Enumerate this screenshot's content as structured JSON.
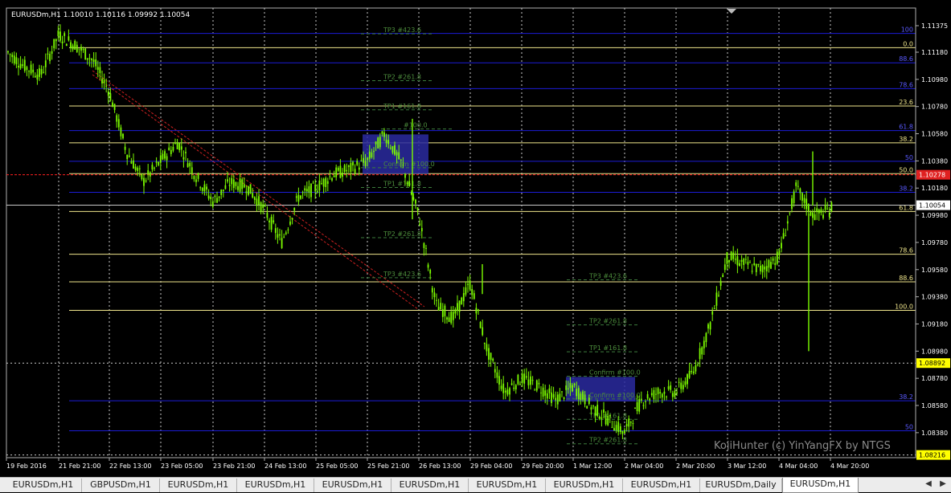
{
  "header": {
    "symbol": "EURUSDm,H1",
    "ohlc": "1.10010 1.10116 1.09992 1.10054"
  },
  "watermark": "KojiHunter (c) YinYangFX by NTGS",
  "tabs": [
    {
      "label": "EURUSDm,H1",
      "active": false
    },
    {
      "label": "GBPUSDm,H1",
      "active": false
    },
    {
      "label": "EURUSDm,H1",
      "active": false
    },
    {
      "label": "EURUSDm,H1",
      "active": false
    },
    {
      "label": "EURUSDm,H1",
      "active": false
    },
    {
      "label": "EURUSDm,H1",
      "active": false
    },
    {
      "label": "EURUSDm,H1",
      "active": false
    },
    {
      "label": "EURUSDm,H1",
      "active": false
    },
    {
      "label": "EURUSDm,H1",
      "active": false
    },
    {
      "label": "EURUSDm,Daily",
      "active": false
    },
    {
      "label": "EURUSDm,H1",
      "active": true
    }
  ],
  "colors": {
    "background": "#000000",
    "candle": "#7CFC00",
    "blue_level": "#1c1cd6",
    "yellow_level": "#f0e68c",
    "grid": "#c8c8c8",
    "red_line": "#ff2020",
    "trend": "#cc2020",
    "label_blue": "#5a5aff",
    "zone": "#2a2aa0"
  },
  "icons": {
    "scroll_left": "arrow-left-icon",
    "scroll_right": "arrow-right-icon"
  },
  "chart_data": {
    "type": "candlestick",
    "symbol": "EURUSDm",
    "timeframe": "H1",
    "x_ticks": [
      "19 Feb 2016",
      "21 Feb 21:00",
      "22 Feb 13:00",
      "23 Feb 05:00",
      "23 Feb 21:00",
      "24 Feb 13:00",
      "25 Feb 05:00",
      "25 Feb 21:00",
      "26 Feb 13:00",
      "29 Feb 04:00",
      "29 Feb 20:00",
      "1 Mar 12:00",
      "2 Mar 04:00",
      "2 Mar 20:00",
      "3 Mar 12:00",
      "4 Mar 04:00",
      "4 Mar 20:00"
    ],
    "y_ticks": [
      1.11375,
      1.1118,
      1.1098,
      1.1078,
      1.1058,
      1.1038,
      1.1018,
      1.0998,
      1.0978,
      1.0958,
      1.0938,
      1.0918,
      1.0898,
      1.0878,
      1.0858,
      1.0838
    ],
    "ylim": [
      1.08196,
      1.11505
    ],
    "current_price": 1.10054,
    "highlighted_prices": [
      {
        "label": "1.10278",
        "price": 1.10278,
        "style": "red"
      },
      {
        "label": "1.10054",
        "price": 1.10054,
        "style": "white"
      },
      {
        "label": "1.08892",
        "price": 1.08892,
        "style": "yellow"
      },
      {
        "label": "1.08216",
        "price": 1.08216,
        "style": "yellow"
      }
    ],
    "fib_levels_right": [
      {
        "label": "100",
        "price": 1.11318,
        "color": "blue"
      },
      {
        "label": "0.0",
        "price": 1.11213,
        "color": "yellow"
      },
      {
        "label": "88.6",
        "price": 1.11102,
        "color": "blue"
      },
      {
        "label": "78.6",
        "price": 1.10912,
        "color": "blue"
      },
      {
        "label": "23.6",
        "price": 1.10784,
        "color": "yellow"
      },
      {
        "label": "61.8",
        "price": 1.10603,
        "color": "blue"
      },
      {
        "label": "38.2",
        "price": 1.10513,
        "color": "yellow"
      },
      {
        "label": "50",
        "price": 1.10377,
        "color": "blue"
      },
      {
        "label": "50.0",
        "price": 1.10286,
        "color": "yellow"
      },
      {
        "label": "38.2",
        "price": 1.10149,
        "color": "blue"
      },
      {
        "label": "61.8",
        "price": 1.10008,
        "color": "yellow"
      },
      {
        "label": "78.6",
        "price": 1.09693,
        "color": "yellow"
      },
      {
        "label": "88.6",
        "price": 1.0949,
        "color": "yellow"
      },
      {
        "label": "100.0",
        "price": 1.0928,
        "color": "yellow"
      },
      {
        "label": "38.2",
        "price": 1.08615,
        "color": "blue"
      },
      {
        "label": "50",
        "price": 1.08394,
        "color": "blue"
      }
    ],
    "trade_labels": [
      {
        "label": "TP3 #423.6",
        "price": 1.11315,
        "time": "25 Feb 13:00"
      },
      {
        "label": "TP2 #261.8",
        "price": 1.1097,
        "time": "25 Feb 13:00"
      },
      {
        "label": "TP1 #161.8",
        "price": 1.10756,
        "time": "25 Feb 13:00"
      },
      {
        "label": "#100.0",
        "price": 1.10615,
        "time": "25 Feb 21:00"
      },
      {
        "label": "Confirm #100.0",
        "price": 1.1033,
        "time": "25 Feb 13:00"
      },
      {
        "label": "TP1 #161.8",
        "price": 1.10184,
        "time": "25 Feb 13:00"
      },
      {
        "label": "TP2 #261.8",
        "price": 1.09815,
        "time": "25 Feb 13:00"
      },
      {
        "label": "TP3 #423.6",
        "price": 1.0952,
        "time": "25 Feb 13:00"
      },
      {
        "label": "TP3 #423.6",
        "price": 1.09505,
        "time": "1 Mar 12:00"
      },
      {
        "label": "TP2 #261.8",
        "price": 1.09173,
        "time": "1 Mar 12:00"
      },
      {
        "label": "TP1 #161.8",
        "price": 1.08975,
        "time": "1 Mar 12:00"
      },
      {
        "label": "Confirm #100.0",
        "price": 1.08795,
        "time": "1 Mar 12:00"
      },
      {
        "label": "Confirm #100.0",
        "price": 1.08628,
        "time": "1 Mar 12:00"
      },
      {
        "label": "TP1 #161.8",
        "price": 1.08478,
        "time": "1 Mar 12:00"
      },
      {
        "label": "TP2 #261.8",
        "price": 1.08298,
        "time": "1 Mar 12:00"
      }
    ],
    "price_path": [
      [
        "19 Feb 2016",
        1.1119
      ],
      [
        "19 Feb 2016",
        1.1108
      ],
      [
        "19 Feb 2016",
        1.1101
      ],
      [
        "21 Feb 21:00",
        1.1131
      ],
      [
        "21 Feb 21:00",
        1.1123
      ],
      [
        "21 Feb 21:00",
        1.1112
      ],
      [
        "22 Feb 13:00",
        1.1089
      ],
      [
        "22 Feb 13:00",
        1.1045
      ],
      [
        "22 Feb 13:00",
        1.1023
      ],
      [
        "23 Feb 05:00",
        1.1038
      ],
      [
        "23 Feb 05:00",
        1.1052
      ],
      [
        "23 Feb 05:00",
        1.1028
      ],
      [
        "23 Feb 21:00",
        1.1008
      ],
      [
        "23 Feb 21:00",
        1.1022
      ],
      [
        "23 Feb 21:00",
        1.1019
      ],
      [
        "24 Feb 13:00",
        1.1002
      ],
      [
        "24 Feb 13:00",
        1.0978
      ],
      [
        "24 Feb 13:00",
        1.1012
      ],
      [
        "25 Feb 05:00",
        1.1018
      ],
      [
        "25 Feb 05:00",
        1.1028
      ],
      [
        "25 Feb 05:00",
        1.1032
      ],
      [
        "25 Feb 21:00",
        1.1038
      ],
      [
        "25 Feb 21:00",
        1.1058
      ],
      [
        "25 Feb 21:00",
        1.1036
      ],
      [
        "26 Feb 13:00",
        1.0998
      ],
      [
        "26 Feb 13:00",
        1.0932
      ],
      [
        "26 Feb 13:00",
        1.0922
      ],
      [
        "29 Feb 04:00",
        1.0948
      ],
      [
        "29 Feb 04:00",
        1.0898
      ],
      [
        "29 Feb 04:00",
        1.0868
      ],
      [
        "29 Feb 20:00",
        1.0878
      ],
      [
        "29 Feb 20:00",
        1.0872
      ],
      [
        "29 Feb 20:00",
        1.0862
      ],
      [
        "1 Mar 12:00",
        1.0872
      ],
      [
        "1 Mar 12:00",
        1.0858
      ],
      [
        "1 Mar 12:00",
        1.0848
      ],
      [
        "2 Mar 04:00",
        1.0838
      ],
      [
        "2 Mar 04:00",
        1.0862
      ],
      [
        "2 Mar 04:00",
        1.0868
      ],
      [
        "2 Mar 20:00",
        1.0868
      ],
      [
        "2 Mar 20:00",
        1.0882
      ],
      [
        "2 Mar 20:00",
        1.0918
      ],
      [
        "3 Mar 12:00",
        1.0968
      ],
      [
        "3 Mar 12:00",
        1.0962
      ],
      [
        "3 Mar 12:00",
        1.0958
      ],
      [
        "4 Mar 04:00",
        1.0968
      ],
      [
        "4 Mar 04:00",
        1.1018
      ],
      [
        "4 Mar 04:00",
        1.0998
      ],
      [
        "4 Mar 20:00",
        1.1002
      ],
      [
        "4 Mar 20:00",
        1.1005
      ]
    ]
  }
}
